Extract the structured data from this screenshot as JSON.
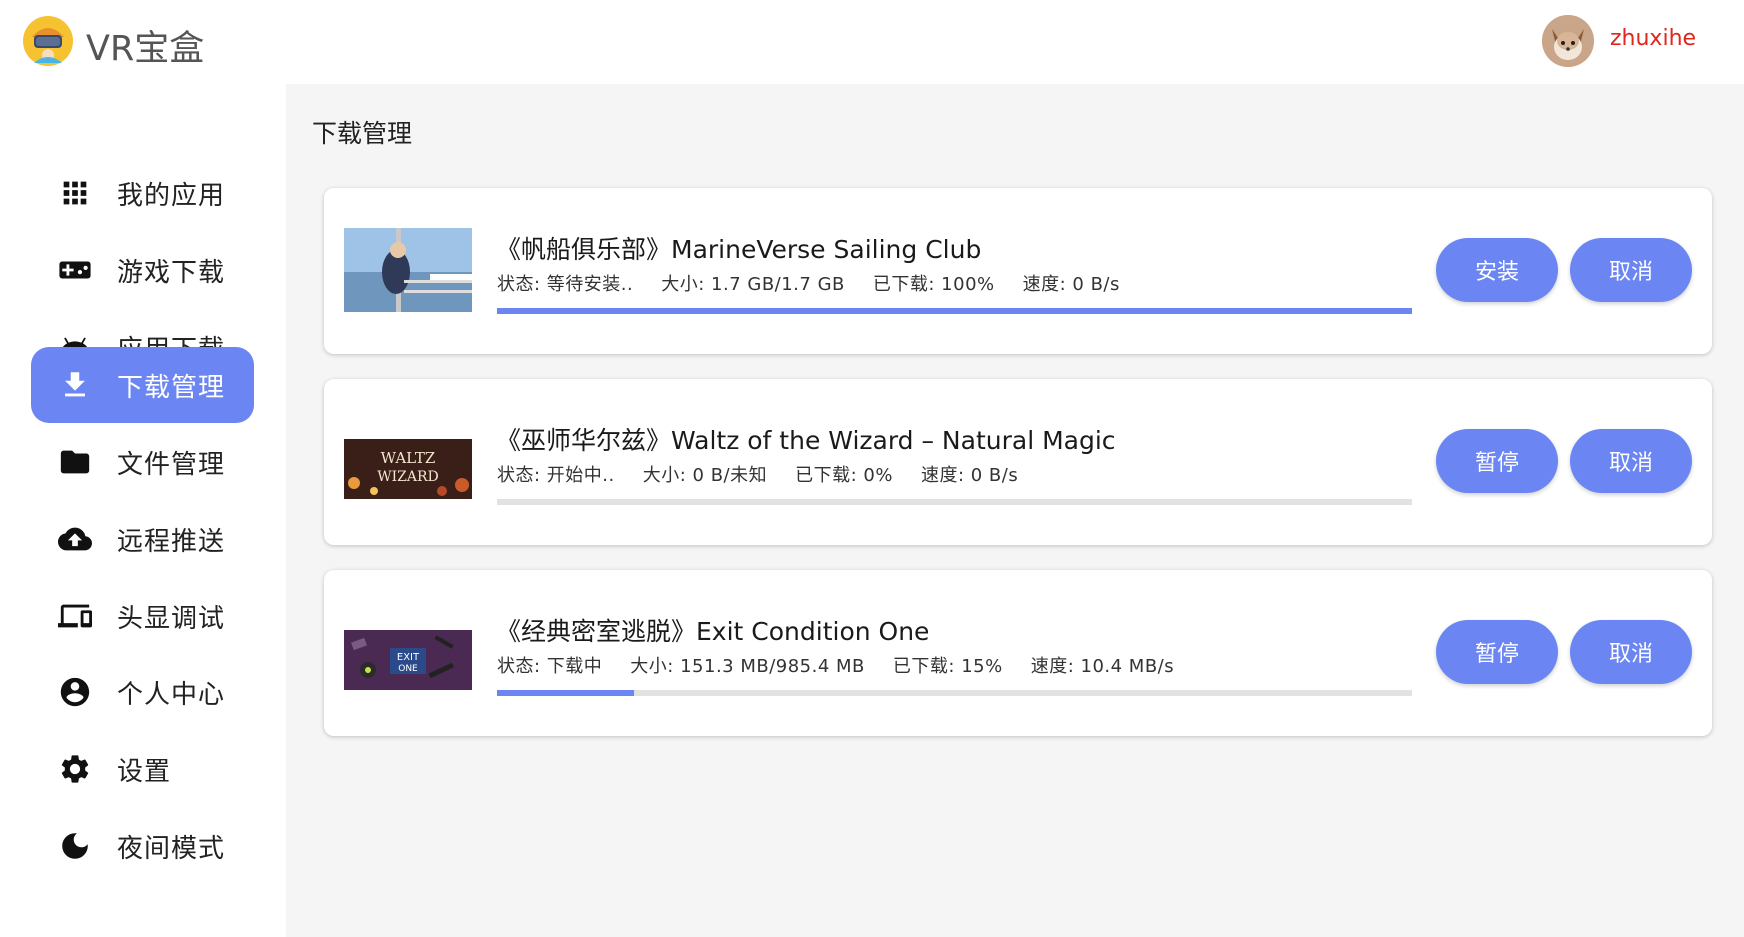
{
  "header": {
    "app_title": "VR宝盒",
    "username": "zhuxihe"
  },
  "sidebar": {
    "items": [
      {
        "label": "我的应用",
        "icon": "apps-grid-icon"
      },
      {
        "label": "游戏下载",
        "icon": "gamepad-icon"
      },
      {
        "label": "应用下载",
        "icon": "android-icon"
      },
      {
        "label": "下载管理",
        "icon": "download-icon",
        "active": true
      },
      {
        "label": "文件管理",
        "icon": "folder-icon"
      },
      {
        "label": "远程推送",
        "icon": "cloud-upload-icon"
      },
      {
        "label": "头显调试",
        "icon": "devices-icon"
      },
      {
        "label": "个人中心",
        "icon": "account-circle-icon"
      },
      {
        "label": "设置",
        "icon": "gear-icon"
      },
      {
        "label": "夜间模式",
        "icon": "moon-icon"
      }
    ]
  },
  "main": {
    "page_title": "下载管理",
    "downloads": [
      {
        "title": "《帆船俱乐部》MarineVerse Sailing Club",
        "status": "状态: 等待安装..",
        "size": "大小: 1.7 GB/1.7 GB",
        "downloaded": "已下载: 100%",
        "speed": "速度: 0 B/s",
        "progress": 1.0,
        "primary_label": "安装",
        "cancel_label": "取消"
      },
      {
        "title": "《巫师华尔兹》Waltz of the Wizard – Natural Magic",
        "status": "状态: 开始中..",
        "size": "大小: 0 B/未知",
        "downloaded": "已下载: 0%",
        "speed": "速度: 0 B/s",
        "progress": 0.0,
        "primary_label": "暂停",
        "cancel_label": "取消",
        "thumb_text": "WALTZ WIZARD"
      },
      {
        "title": "《经典密室逃脱》Exit Condition One",
        "status": "状态: 下载中",
        "size": "大小: 151.3 MB/985.4 MB",
        "downloaded": "已下载: 15%",
        "speed": "速度: 10.4 MB/s",
        "progress": 0.15,
        "primary_label": "暂停",
        "cancel_label": "取消",
        "thumb_text": "EXIT ONE"
      }
    ]
  },
  "colors": {
    "accent": "#6b86f2",
    "username": "#e0261d",
    "main_bg": "#f5f5f5"
  }
}
